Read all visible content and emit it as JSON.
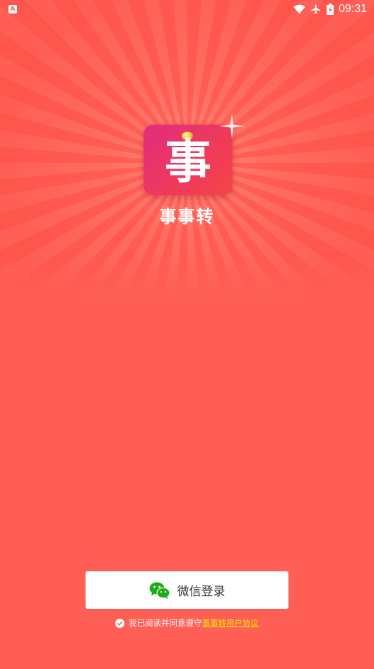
{
  "status_bar": {
    "time": "09:31",
    "left_icon_letter": "A"
  },
  "app": {
    "icon_character": "事",
    "name": "事事转"
  },
  "login": {
    "button_label": "微信登录"
  },
  "agreement": {
    "prefix": "我已阅读并同意遵守",
    "link_text": "事事转用户协议"
  },
  "colors": {
    "background": "#FF5F55",
    "link": "#FFEA00",
    "wechat_green": "#1AAD19"
  }
}
